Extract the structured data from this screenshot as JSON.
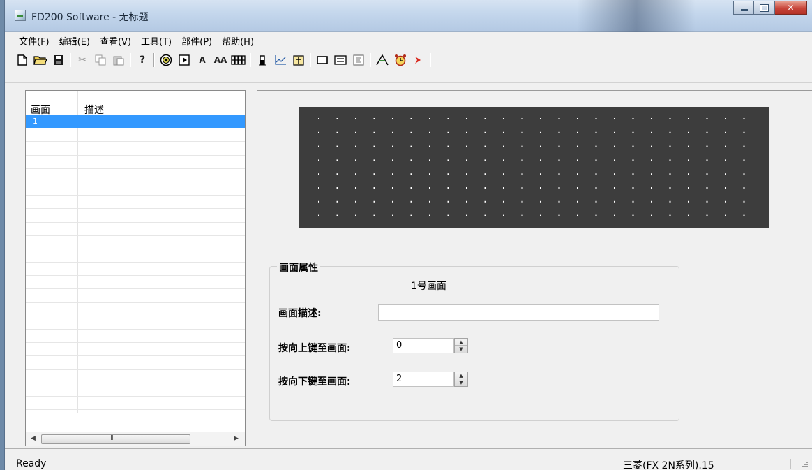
{
  "window": {
    "title": "FD200 Software - 无标题",
    "controls": {
      "minimize": "—",
      "maximize": "□",
      "close": "✕"
    }
  },
  "menu": [
    {
      "label": "文件(F)"
    },
    {
      "label": "编辑(E)"
    },
    {
      "label": "查看(V)"
    },
    {
      "label": "工具(T)"
    },
    {
      "label": "部件(P)"
    },
    {
      "label": "帮助(H)"
    }
  ],
  "toolbar": {
    "text_button": "A",
    "large_text_button": "AA",
    "icons": [
      "new-file-icon",
      "open-folder-icon",
      "save-icon",
      "cut-icon",
      "copy-icon",
      "paste-icon",
      "help-icon",
      "target-icon",
      "play-icon",
      "text-icon",
      "large-text-icon",
      "numeric-display-icon",
      "bar-icon",
      "trend-chart-icon",
      "bitmap-icon",
      "frame-icon",
      "keypad-icon",
      "screen-icon",
      "download-icon",
      "alarm-clock-icon",
      "arrow-right-icon"
    ]
  },
  "screen_list": {
    "columns": [
      "画面",
      "描述"
    ],
    "rows": [
      {
        "id": "1",
        "description": ""
      }
    ],
    "scroll_grip": "III",
    "scroll_left": "◀",
    "scroll_right": "▶"
  },
  "lcd": {
    "background": "#3d3d3d",
    "dot_color": "#ffffff",
    "dot_rows": 8,
    "dot_cols": 24
  },
  "properties": {
    "group_title": "画面属性",
    "screen_name": "1号画面",
    "description_label": "画面描述:",
    "description_value": "",
    "up_key_label": "按向上键至画面:",
    "up_key_value": "0",
    "down_key_label": "按向下键至画面:",
    "down_key_value": "2"
  },
  "status": {
    "left": "Ready",
    "plc": "三菱(FX 2N系列).15"
  }
}
